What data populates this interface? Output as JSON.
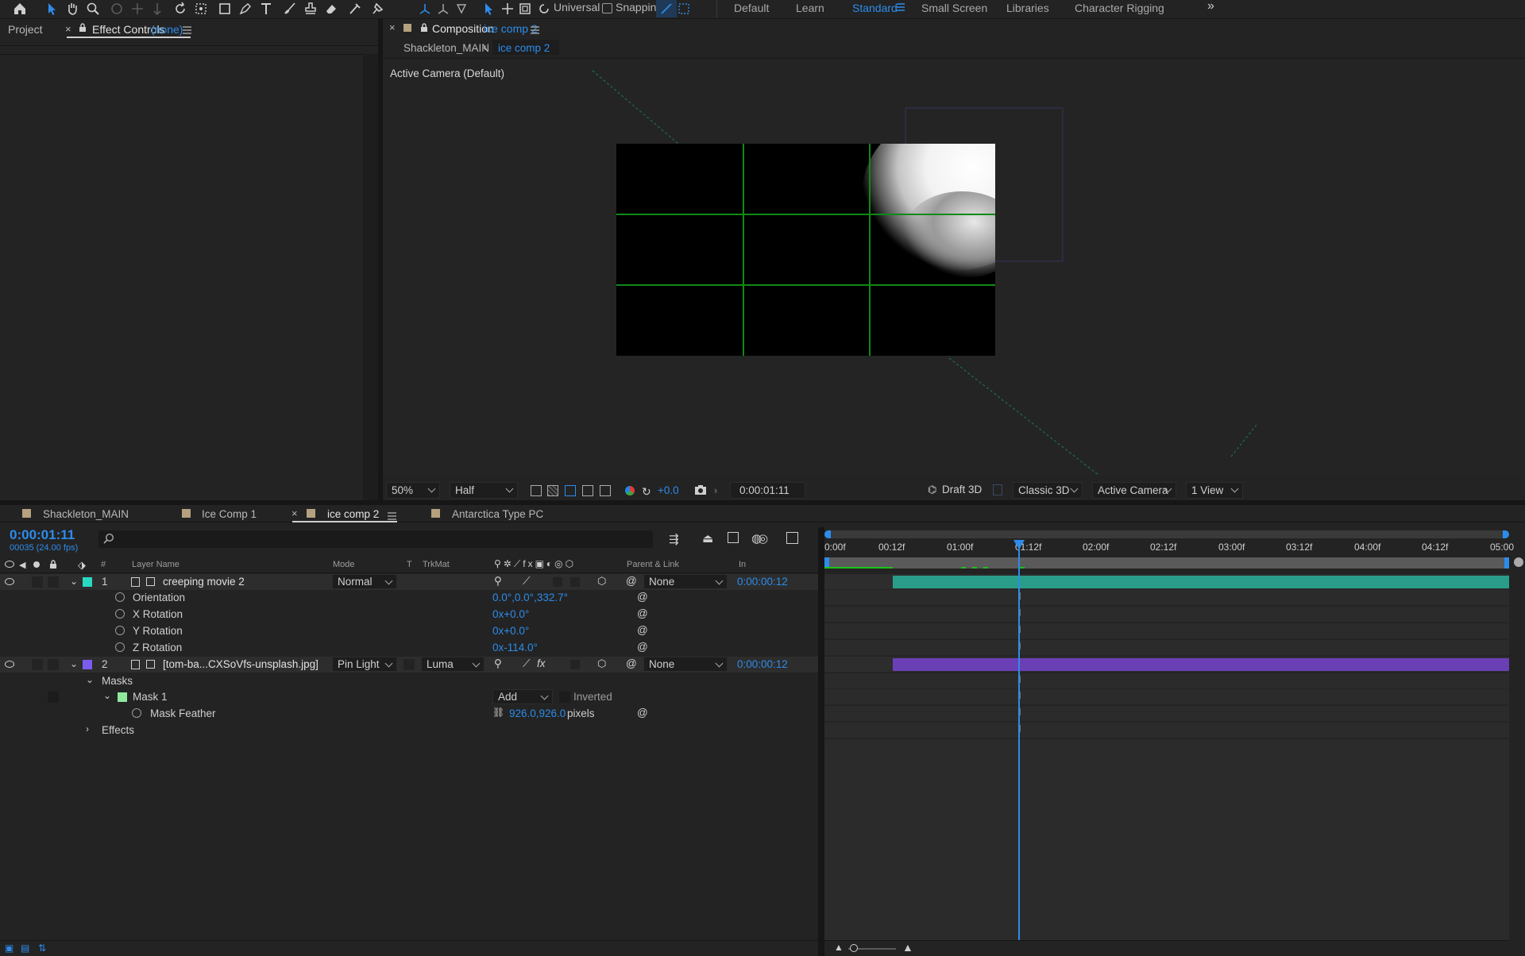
{
  "toolbar": {
    "mode_label": "Universal",
    "snapping_label": "Snapping",
    "workspaces": [
      "Default",
      "Learn",
      "Standard",
      "Small Screen",
      "Libraries",
      "Character Rigging"
    ],
    "active_workspace": "Standard",
    "overflow": "»"
  },
  "left_panel": {
    "tab_project": "Project",
    "tab_effect_controls": "Effect Controls",
    "effect_controls_target": "(none)"
  },
  "comp_panel": {
    "tab_label": "Composition",
    "tab_comp": "ice comp 2",
    "breadcrumb_parent": "Shackleton_MAIN",
    "breadcrumb_current": "ice comp 2",
    "camera_label": "Active Camera (Default)",
    "viewer_controls": {
      "zoom": "50%",
      "resolution": "Half",
      "exposure": "+0.0",
      "timecode": "0:00:01:11",
      "draft3d": "Draft 3D",
      "renderer": "Classic 3D",
      "view": "Active Camera ...",
      "views_count": "1 View"
    }
  },
  "timeline": {
    "tabs": [
      "Shackleton_MAIN",
      "Ice Comp 1",
      "ice comp 2",
      "Antarctica Type PC"
    ],
    "active_tab": "ice comp 2",
    "current_time": "0:00:01:11",
    "frame_info": "00035 (24.00 fps)",
    "search_placeholder": "",
    "columns": {
      "num": "#",
      "layer_name": "Layer Name",
      "mode": "Mode",
      "t": "T",
      "trkmat": "TrkMat",
      "parent": "Parent & Link",
      "in": "In"
    },
    "ruler_ticks": [
      "0:00f",
      "00:12f",
      "01:00f",
      "01:12f",
      "02:00f",
      "02:12f",
      "03:00f",
      "03:12f",
      "04:00f",
      "04:12f",
      "05:00"
    ],
    "layer1": {
      "num": "1",
      "name": "creeping movie 2",
      "mode": "Normal",
      "parent": "None",
      "in": "0:00:00:12",
      "label_color": "#29d9c2",
      "bar_color": "#2a9d8a",
      "props": [
        {
          "name": "Orientation",
          "value": "0.0°,0.0°,332.7°"
        },
        {
          "name": "X Rotation",
          "value": "0x+0.0°"
        },
        {
          "name": "Y Rotation",
          "value": "0x+0.0°"
        },
        {
          "name": "Z Rotation",
          "value": "0x-114.0°"
        }
      ]
    },
    "layer2": {
      "num": "2",
      "name": "[tom-ba...CXSoVfs-unsplash.jpg]",
      "mode": "Pin Light",
      "trkmat": "Luma",
      "parent": "None",
      "in": "0:00:00:12",
      "label_color": "#7b5cf0",
      "bar_color": "#6a3fb6",
      "masks_label": "Masks",
      "mask1_label": "Mask 1",
      "mask1_mode": "Add",
      "inverted_label": "Inverted",
      "mask_feather_label": "Mask Feather",
      "mask_feather_value": "926.0,926.0",
      "mask_feather_unit": "pixels",
      "effects_label": "Effects"
    }
  }
}
